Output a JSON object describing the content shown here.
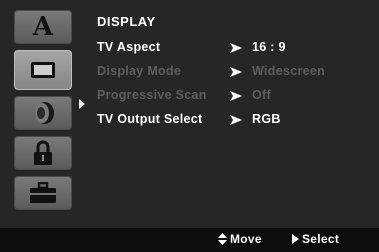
{
  "menu": {
    "title": "DISPLAY",
    "rows": [
      {
        "label": "TV Aspect",
        "value": "16 : 9",
        "enabled": true
      },
      {
        "label": "Display Mode",
        "value": "Widescreen",
        "enabled": false
      },
      {
        "label": "Progressive Scan",
        "value": "Off",
        "enabled": false
      },
      {
        "label": "TV Output Select",
        "value": "RGB",
        "enabled": true
      }
    ]
  },
  "sidebar": {
    "items": [
      {
        "icon": "language-a-icon",
        "label": "A"
      },
      {
        "icon": "tv-display-icon"
      },
      {
        "icon": "speaker-audio-icon"
      },
      {
        "icon": "padlock-icon"
      },
      {
        "icon": "briefcase-others-icon"
      }
    ],
    "active_index": 1
  },
  "footer": {
    "move_label": "Move",
    "select_label": "Select"
  },
  "colors": {
    "background": "#262626",
    "text": "#ffffff",
    "disabled_text": "#5e5e5e",
    "bottom_bar": "#0d0d0d"
  }
}
